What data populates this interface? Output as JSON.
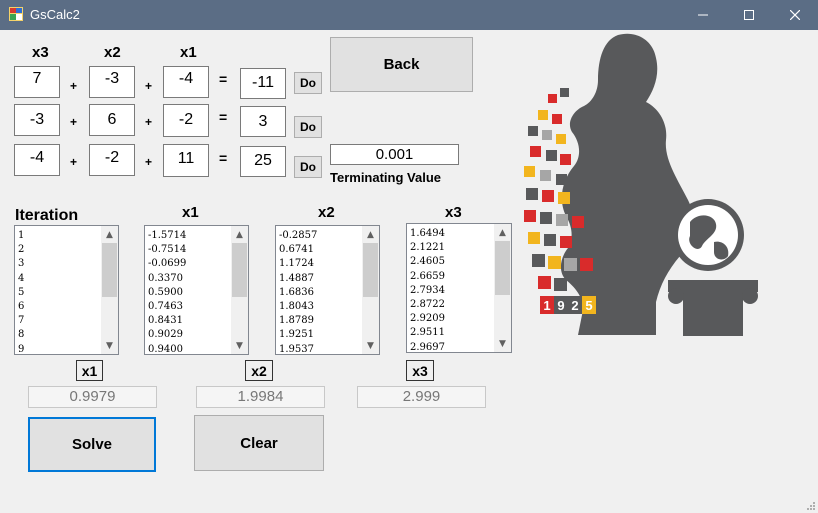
{
  "window": {
    "title": "GsCalc2"
  },
  "headers": {
    "x3": "x3",
    "x2": "x2",
    "x1": "x1"
  },
  "ops": {
    "plus": "+",
    "equals": "="
  },
  "equations": [
    {
      "a": "7",
      "b": "-3",
      "c": "-4",
      "d": "-11",
      "do_label": "Do"
    },
    {
      "a": "-3",
      "b": "6",
      "c": "-2",
      "d": "3",
      "do_label": "Do"
    },
    {
      "a": "-4",
      "b": "-2",
      "c": "11",
      "d": "25",
      "do_label": "Do"
    }
  ],
  "back_label": "Back",
  "terminating": {
    "value": "0.001",
    "label": "Terminating Value"
  },
  "lists": {
    "iteration": {
      "title": "Iteration",
      "items": [
        "1",
        "2",
        "3",
        "4",
        "5",
        "6",
        "7",
        "8",
        "9"
      ]
    },
    "x1": {
      "title": "x1",
      "items": [
        "-1.5714",
        "-0.7514",
        "-0.0699",
        "0.3370",
        "0.5900",
        "0.7463",
        "0.8431",
        "0.9029",
        "0.9400"
      ]
    },
    "x2": {
      "title": "x2",
      "items": [
        "-0.2857",
        "0.6741",
        "1.1724",
        "1.4887",
        "1.6836",
        "1.8043",
        "1.8789",
        "1.9251",
        "1.9537"
      ]
    },
    "x3": {
      "title": "x3",
      "items": [
        "1.6494",
        "2.1221",
        "2.4605",
        "2.6659",
        "2.7934",
        "2.8722",
        "2.9209",
        "2.9511",
        "2.9697"
      ]
    }
  },
  "results": {
    "x1": {
      "label": "x1",
      "value": "0.9979"
    },
    "x2": {
      "label": "x2",
      "value": "1.9984"
    },
    "x3": {
      "label": "x3",
      "value": "2.999"
    }
  },
  "solve_label": "Solve",
  "clear_label": "Clear",
  "logo": {
    "year": [
      "1",
      "9",
      "2",
      "5"
    ]
  },
  "colors": {
    "titlebar": "#5b6d85",
    "silhouette": "#58595b",
    "accent_red": "#d92b2b",
    "accent_yellow": "#f2b51e"
  }
}
